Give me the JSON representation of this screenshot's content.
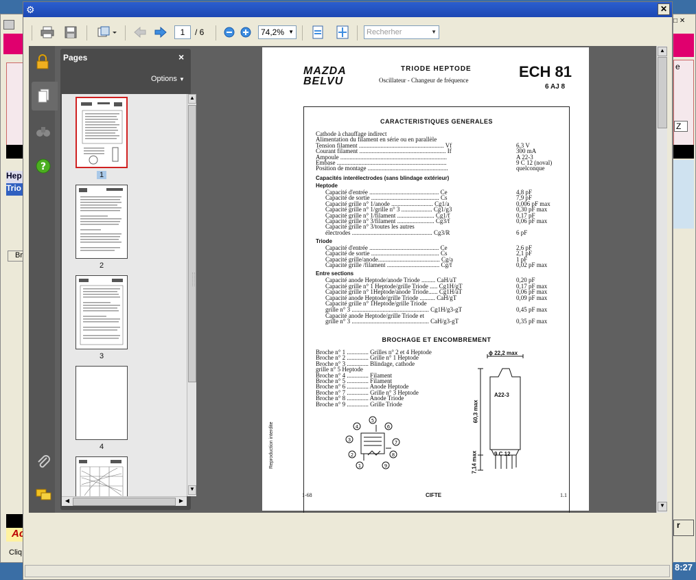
{
  "toolbar": {
    "page_current": "1",
    "page_total": "/ 6",
    "zoom": "74,2%",
    "search_placeholder": "Recherher"
  },
  "pages_panel": {
    "title": "Pages",
    "close": "×",
    "options": "Options",
    "thumb_labels": [
      "1",
      "2",
      "3",
      "4"
    ]
  },
  "document": {
    "brand_line1": "MAZDA",
    "brand_line2": "BELVU",
    "tube_type": "TRIODE HEPTODE",
    "tube_use": "Oscillateur - Changeur de fréquence",
    "model": "ECH 81",
    "model_alt": "6 AJ 8",
    "section_general": "CARACTERISTIQUES GENERALES",
    "general_lines": [
      "Cathode à chauffage indirect",
      "Alimentation du filament en série ou en parallèle",
      "Tension filament .......................................................   Vf",
      "Courant filament ........................................................   If",
      "Ampoule .....................................................................",
      "Embase .......................................................................",
      "Position de montage ...................................................."
    ],
    "general_values": [
      "",
      "",
      "6,3 V",
      "300 mA",
      "A 22-3",
      "9 C 12 (noval)",
      "quelconque"
    ],
    "cap_title": "Capacités interélectrodes (sans blindage extérieur)",
    "heptode_title": "Heptode",
    "heptode_lines": [
      "Capacité d'entrée .............................................  Ce",
      "Capacité de sortie ............................................  Cs",
      "Capacité grille n° 1/anode ...........................  Cg1/a",
      "Capacité grille n° 1/grille n° 3 ....................  Cg1/g3",
      "Capacité grille n° 1/filament ........................  Cg1/f",
      "Capacité grille n° 3/filament ........................  Cg3/f",
      "Capacité grille n° 3/toutes les autres",
      "    électrodes ....................................................  Cg3/R"
    ],
    "heptode_values": [
      "4,8 pF",
      "7,9 pF",
      "0,006 pF max",
      "0,30 pF max",
      "0,17 pF",
      "0,06 pF max",
      "",
      "6 pF"
    ],
    "triode_title": "Triode",
    "triode_lines": [
      "Capacité d'entrée .............................................  Ce",
      "Capacité de sortie ............................................  Cs",
      "Capacité grille/anode........................................  Cg/a",
      "Capacité grille /filament ..................................  Cg/f"
    ],
    "triode_values": [
      "2,6 pF",
      "2,1 pF",
      "1 pF",
      "0,02 pF max"
    ],
    "entre_title": "Entre sections",
    "entre_lines": [
      "Capacité anode Heptode/anode Triode .........  CaH/aT",
      "Capacité grille n° 1 Heptode/grille Triode .....  Cg1H/gT",
      "Capacité grille n° 1Heptode/anode Triode......  Cg1H/aT",
      "Capacité anode Heptode/grille Triode ..........  CaH/gT",
      "Capacité grille n° 1Heptode/grille Triode",
      "   grille n° 3 ..................................................  Cg1H/g3-gT",
      "Capacité anode Heptode/grille Triode et",
      "   grille n° 3 ..................................................  CaH/g3-gT"
    ],
    "entre_values": [
      "0,20 pF",
      "0,17 pF max",
      "0,06 pF max",
      "0,09 pF max",
      "",
      "0,45 pF max",
      "",
      "0,35 pF max"
    ],
    "section_brochage": "BROCHAGE ET ENCOMBREMENT",
    "broche_lines": [
      "Broche n° 1 .............. Grilles n° 2 et 4 Heptode",
      "Broche n° 2 .............. Grille n° 1 Heptode",
      "Broche n° 3 .............. Blindage, cathode",
      "                                    grille n° 5 Heptode",
      "Broche n° 4 .............. Filament",
      "Broche n° 5 .............. Filament",
      "Broche n° 6 .............. Anode Heptode",
      "Broche n° 7 .............. Grille n° 3 Heptode",
      "Broche n° 8 .............. Anode Triode",
      "Broche n° 9 .............. Grille Triode"
    ],
    "dim_diameter": "ϕ 22,2 max",
    "dim_bulb": "A22-3",
    "dim_height": "60,3 max",
    "dim_base": "9 C 12",
    "dim_pins": "7,14 max",
    "side_note": "Reproduction interdite",
    "footer_left": "1-68",
    "footer_center": "CIFTE",
    "footer_right": "1.1"
  },
  "background": {
    "left_fragments": [
      "Hep",
      "Trio",
      "Br",
      "Ac",
      "Cliq"
    ],
    "right_fragments": [
      "e",
      "Z",
      "r",
      "8:27"
    ]
  }
}
